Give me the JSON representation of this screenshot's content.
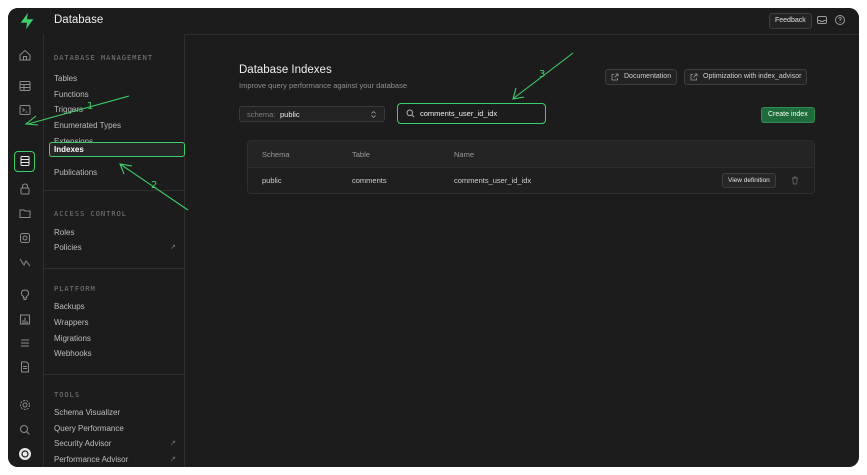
{
  "app": {
    "title": "Database",
    "feedback_label": "Feedback"
  },
  "nav": {
    "sections": [
      {
        "title": "DATABASE MANAGEMENT",
        "items": [
          "Tables",
          "Functions",
          "Triggers",
          "Enumerated Types",
          "Extensions",
          "Indexes",
          "Publications"
        ]
      },
      {
        "title": "ACCESS CONTROL",
        "items": [
          "Roles",
          "Policies"
        ]
      },
      {
        "title": "PLATFORM",
        "items": [
          "Backups",
          "Wrappers",
          "Migrations",
          "Webhooks"
        ]
      },
      {
        "title": "TOOLS",
        "items": [
          "Schema Visualizer",
          "Query Performance",
          "Security Advisor",
          "Performance Advisor"
        ]
      }
    ],
    "active_item": "Indexes"
  },
  "main": {
    "title": "Database Indexes",
    "subtitle": "Improve query performance against your database",
    "documentation_label": "Documentation",
    "optimization_label": "Optimization with index_advisor",
    "schema_label": "schema:",
    "schema_value": "public",
    "search_value": "comments_user_id_idx",
    "create_label": "Create index",
    "table": {
      "headers": [
        "Schema",
        "Table",
        "Name"
      ],
      "rows": [
        {
          "schema": "public",
          "table": "comments",
          "name": "comments_user_id_idx",
          "action": "View definition"
        }
      ]
    }
  },
  "annotations": [
    "1",
    "2",
    "3"
  ],
  "colors": {
    "accent": "#3ecf6a",
    "background": "#1c1c1c"
  }
}
